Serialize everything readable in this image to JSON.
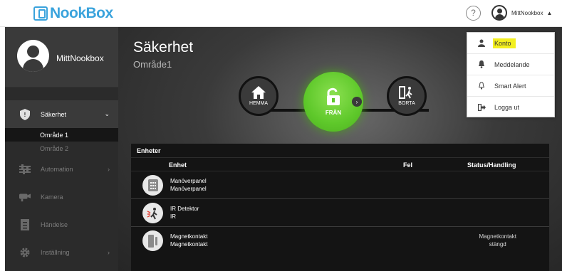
{
  "app": {
    "logo_text": "NookBox",
    "brand_color": "#3aa3dc"
  },
  "topbar": {
    "help_label": "?",
    "user_name": "MittNookbox",
    "caret": "▲"
  },
  "sidebar": {
    "profile_name": "MittNookbox",
    "items": [
      {
        "label": "Säkerhet",
        "icon": "shield-icon",
        "caret": "⌄"
      },
      {
        "label": "Automation",
        "icon": "sliders-icon",
        "caret": "›"
      },
      {
        "label": "Kamera",
        "icon": "camera-icon",
        "caret": ""
      },
      {
        "label": "Händelse",
        "icon": "list-icon",
        "caret": ""
      },
      {
        "label": "Inställning",
        "icon": "gear-icon",
        "caret": "›"
      }
    ],
    "subitems": [
      "Område 1",
      "Område 2"
    ]
  },
  "main": {
    "title": "Säkerhet",
    "area": "Område1",
    "modes": {
      "home": "HEMMA",
      "off": "FRÅN",
      "away": "BORTA"
    },
    "active_color": "#5ec82a"
  },
  "devices": {
    "header": "Enheter",
    "columns": [
      "Enhet",
      "Fel",
      "Status/Handling"
    ],
    "rows": [
      {
        "name": "Manöverpanel",
        "type": "Manöverpanel",
        "icon": "keypad-icon",
        "status1": "",
        "status2": ""
      },
      {
        "name": "IR Detektor",
        "type": "IR",
        "icon": "motion-detector-icon",
        "status1": "",
        "status2": ""
      },
      {
        "name": "Magnetkontakt",
        "type": "Magnetkontakt",
        "icon": "door-contact-icon",
        "status1": "Magnetkontakt",
        "status2": "stängd"
      }
    ]
  },
  "dropdown": {
    "items": [
      {
        "label": "Konto",
        "icon": "user-icon"
      },
      {
        "label": "Meddelande",
        "icon": "bell-icon"
      },
      {
        "label": "Smart Alert",
        "icon": "bell-outline-icon"
      },
      {
        "label": "Logga ut",
        "icon": "logout-icon"
      }
    ],
    "highlight_color": "#f3ef20"
  }
}
